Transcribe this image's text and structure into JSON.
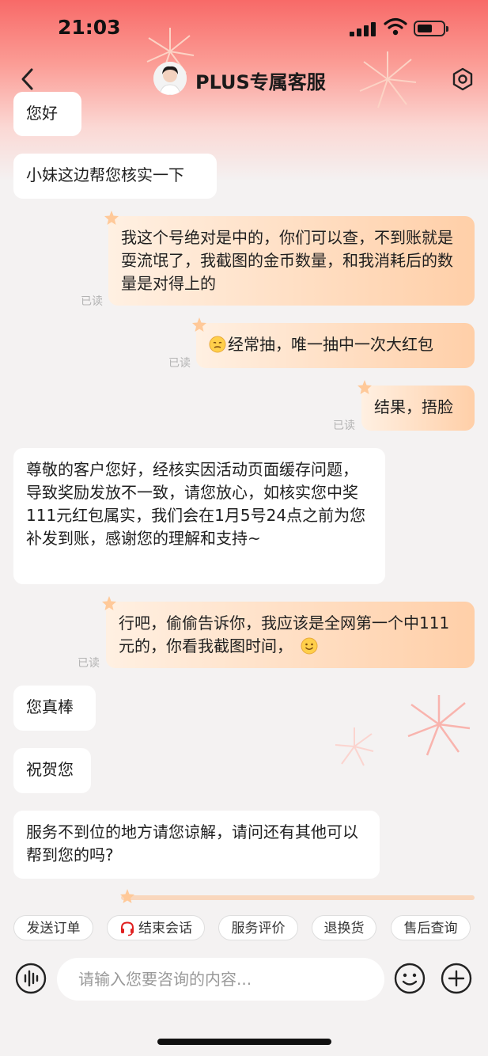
{
  "status_bar": {
    "time": "21:03"
  },
  "header": {
    "title": "PLUS专属客服"
  },
  "messages": [
    {
      "side": "in",
      "text": "您好"
    },
    {
      "side": "in",
      "text": "小妹这边帮您核实一下"
    },
    {
      "side": "out",
      "text": "我这个号绝对是中的，你们可以查，不到账就是耍流氓了，我截图的金币数量，和我消耗后的数量是对得上的",
      "status": "已读"
    },
    {
      "side": "out",
      "text": "经常抽，唯一抽中一次大红包",
      "status": "已读"
    },
    {
      "side": "out",
      "text": "结果，捂脸",
      "status": "已读"
    },
    {
      "side": "in",
      "text": "尊敬的客户您好，经核实因活动页面缓存问题，导致奖励发放不一致，请您放心，如核实您中奖 111元红包属实，我们会在1月5号24点之前为您补发到账，感谢您的理解和支持~"
    },
    {
      "side": "out",
      "text": "行吧，偷偷告诉你，我应该是全网第一个中111元的，你看我截图时间，",
      "status": "已读"
    },
    {
      "side": "in",
      "text": "您真棒"
    },
    {
      "side": "in",
      "text": "祝贺您"
    },
    {
      "side": "in",
      "text": "服务不到位的地方请您谅解，请问还有其他可以帮到您的吗?"
    }
  ],
  "quick_actions": [
    "发送订单",
    "结束会话",
    "服务评价",
    "退换货",
    "售后查询"
  ],
  "composer": {
    "placeholder": "请输入您要咨询的内容..."
  },
  "colors": {
    "header_red": "#f86a68",
    "bubble_out": "#ffcfa8",
    "bubble_in": "#ffffff",
    "accent": "#e02020"
  }
}
